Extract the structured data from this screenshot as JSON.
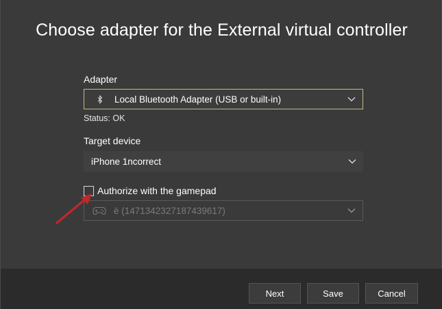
{
  "dialog": {
    "title": "Choose adapter for the External virtual controller"
  },
  "adapter": {
    "label": "Adapter",
    "icon": "bluetooth-icon",
    "selected": "Local Bluetooth Adapter (USB or built-in)",
    "status": "Status: OK"
  },
  "target_device": {
    "label": "Target device",
    "selected": "iPhone 1ncorrect"
  },
  "authorize": {
    "label": "Authorize with the gamepad",
    "checked": false,
    "gamepad_icon": "gamepad-icon",
    "gamepad_selected": "ё (1471342327187439617)"
  },
  "buttons": {
    "next": "Next",
    "save": "Save",
    "cancel": "Cancel"
  },
  "colors": {
    "background": "#3a3a3a",
    "footer": "#2b2b2b",
    "focus_border": "#c9b98a",
    "arrow": "#c0282a"
  }
}
